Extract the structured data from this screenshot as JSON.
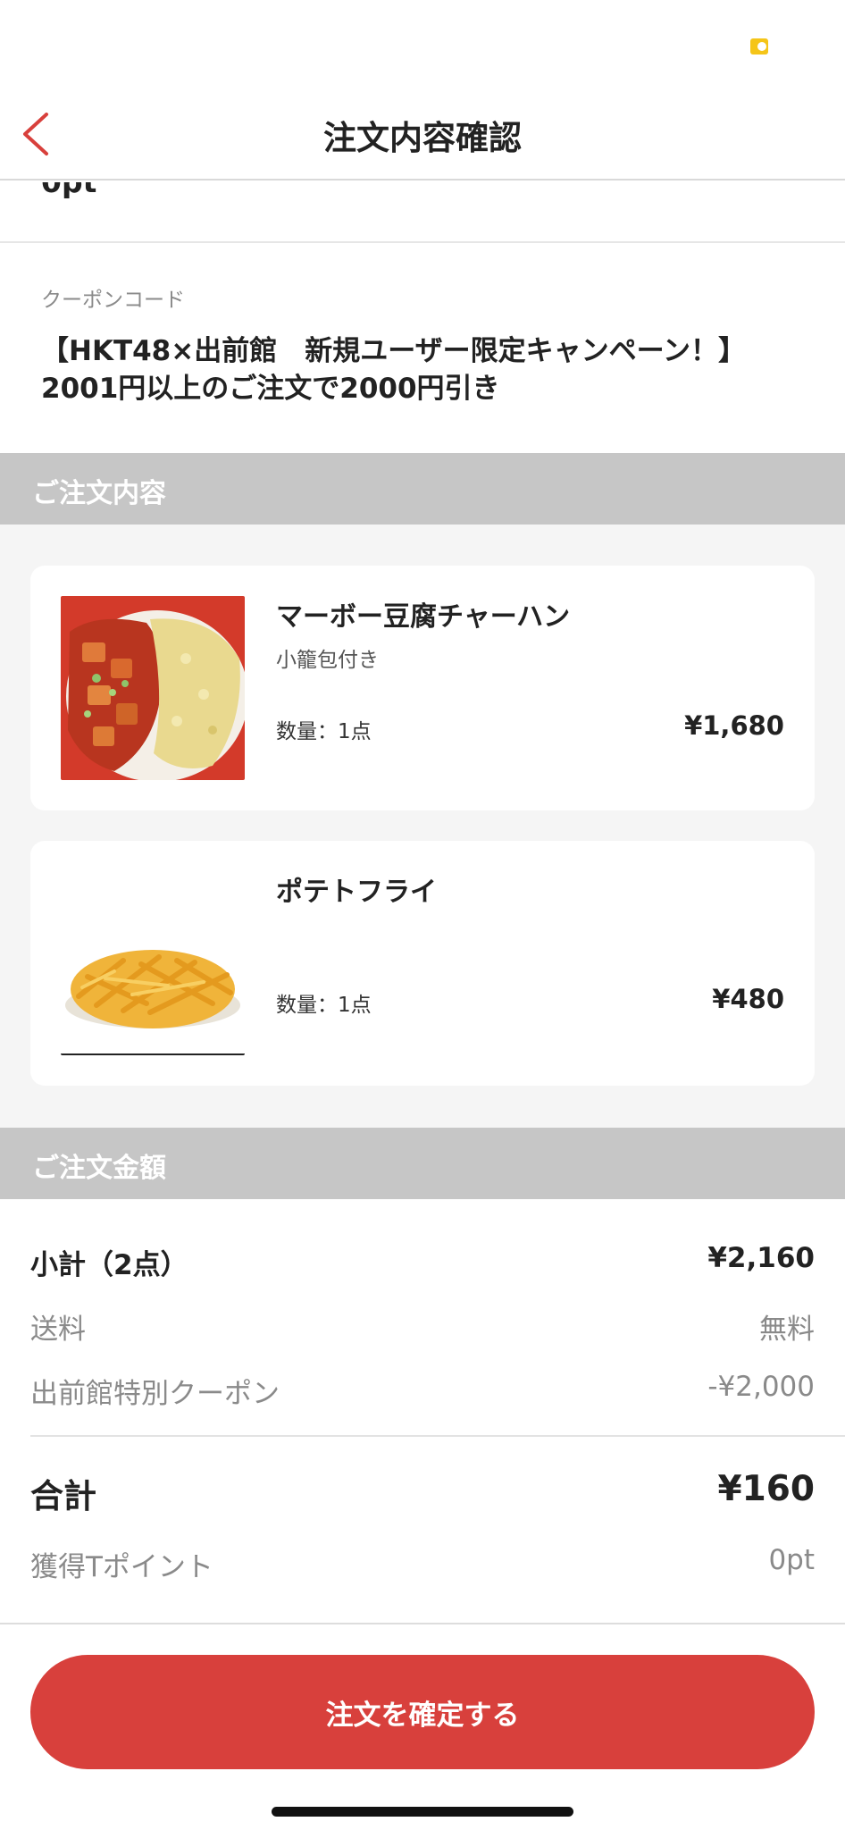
{
  "nav": {
    "title": "注文内容確認"
  },
  "points_stub": {
    "value": "0pt"
  },
  "coupon": {
    "label": "クーポンコード",
    "line1": "【HKT48×出前館　新規ユーザー限定キャンペーン！】",
    "line2": "2001円以上のご注文で2000円引き"
  },
  "order_section": {
    "header": "ご注文内容",
    "items": [
      {
        "name": "マーボー豆腐チャーハン",
        "option": "小籠包付き",
        "quantity": "数量：1点",
        "price": "¥1,680"
      },
      {
        "name": "ポテトフライ",
        "option": "",
        "quantity": "数量：1点",
        "price": "¥480"
      }
    ]
  },
  "amount_section": {
    "header": "ご注文金額",
    "subtotal_label": "小計（2点）",
    "subtotal_value": "¥2,160",
    "delivery_label": "送料",
    "delivery_value": "無料",
    "coupon_label": "出前館特別クーポン",
    "coupon_value": "-¥2,000",
    "total_label": "合計",
    "total_value": "¥160",
    "points_label": "獲得Tポイント",
    "points_value": "0pt"
  },
  "confirm_button": {
    "label": "注文を確定する"
  },
  "colors": {
    "accent_red": "#d8403c",
    "section_header_gray": "#c6c6c6",
    "background_gray": "#f5f5f5"
  }
}
